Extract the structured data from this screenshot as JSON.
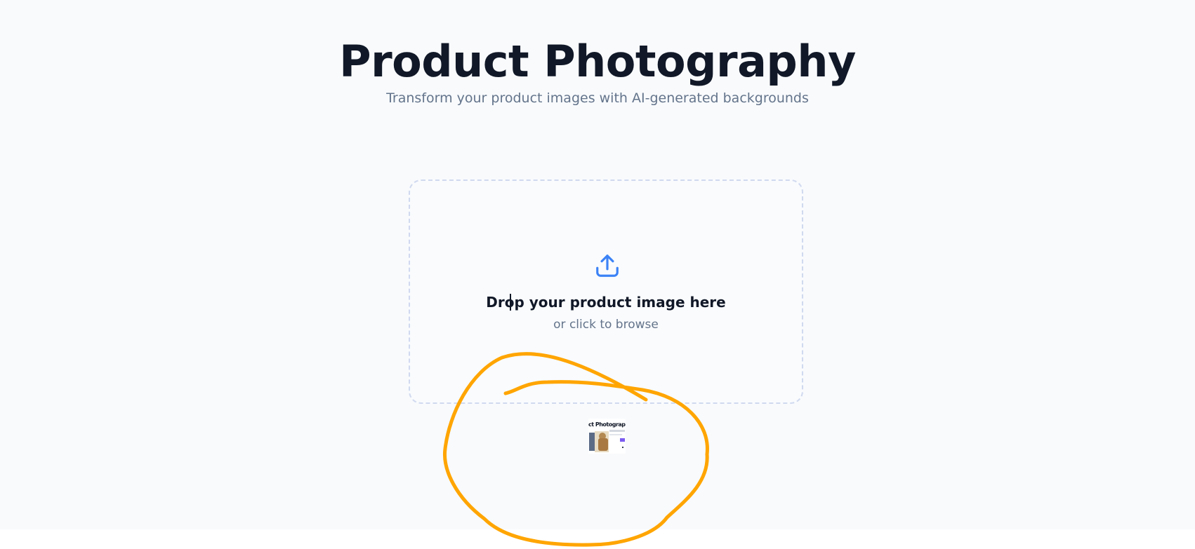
{
  "header": {
    "title": "Product Photography",
    "subtitle": "Transform your product images with AI-generated backgrounds"
  },
  "upload": {
    "icon": "upload-icon",
    "title": "Drop your product image here",
    "subtitle": "or click to browse",
    "accent_color": "#3b82f6"
  },
  "thumbnail": {
    "caption": "ct Photography"
  },
  "annotation": {
    "color": "#ffa500"
  }
}
